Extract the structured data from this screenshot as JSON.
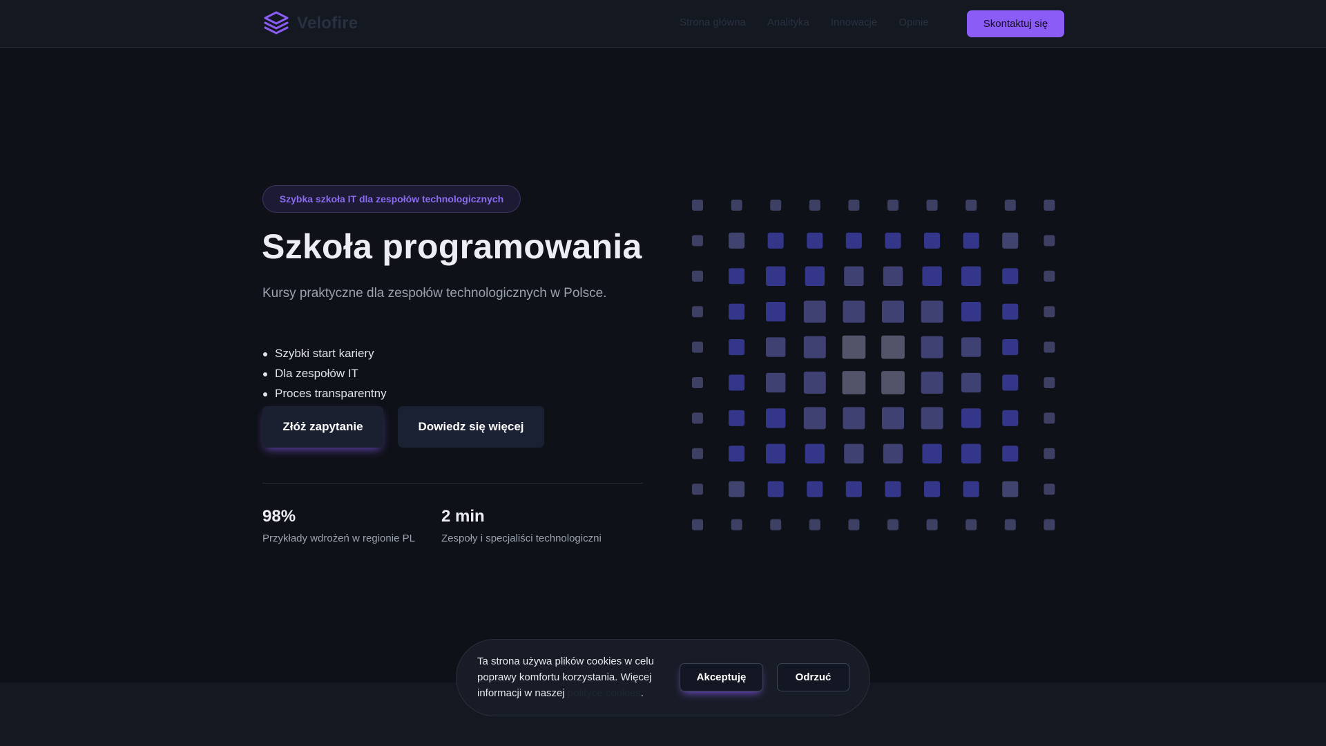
{
  "brand": {
    "name": "Velofire",
    "icon": "layers-icon"
  },
  "nav": {
    "items": [
      "Strona główna",
      "Analityka",
      "Innowacje",
      "Opinie"
    ],
    "cta_label": "Skontaktuj się"
  },
  "hero": {
    "badge": "Szybka szkoła IT dla zespołów technologicznych",
    "title": "Szkoła programowania",
    "subtitle": "Kursy praktyczne dla zespołów technologicznych w Polsce.",
    "features": [
      "Szybki start kariery",
      "Dla zespołów IT",
      "Proces transparentny"
    ],
    "primary_button": "Złóż zapytanie",
    "secondary_button": "Dowiedz się więcej"
  },
  "stats": [
    {
      "value": "98%",
      "label": "Przykłady wdrożeń w regionie PL"
    },
    {
      "value": "2 min",
      "label": "Zespoły i specjaliści technologiczni"
    }
  ],
  "cookie": {
    "text_before": "Ta strona używa plików cookies w celu poprawy komfortu korzystania. Więcej informacji w naszej ",
    "link": "polityce cookies",
    "text_after": ".",
    "accept": "Akceptuję",
    "reject": "Odrzuć"
  },
  "colors": {
    "accent": "#8b5cf6",
    "background": "#0e1117",
    "header": "#141821"
  }
}
